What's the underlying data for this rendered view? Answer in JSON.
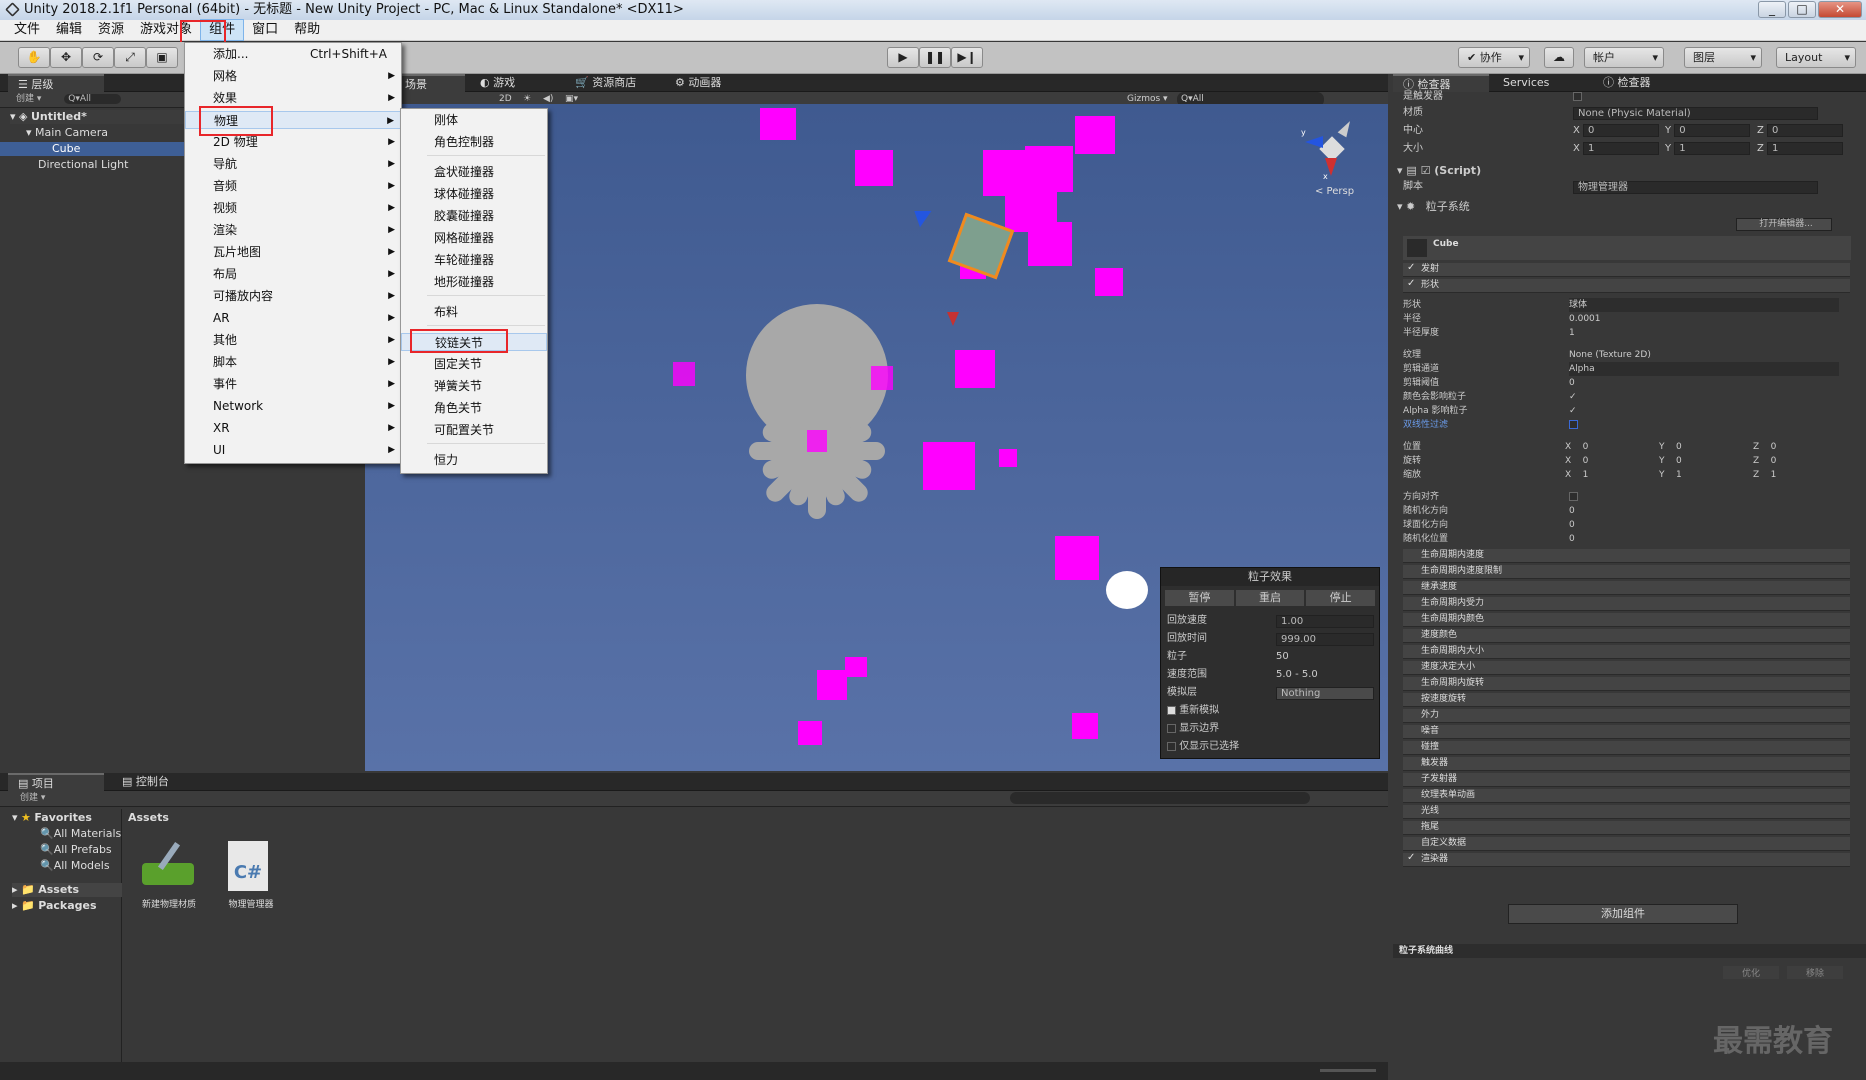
{
  "window": {
    "title": "Unity 2018.2.1f1 Personal (64bit) - 无标题 - New Unity Project - PC, Mac & Linux Standalone* <DX11>",
    "controls": [
      "_",
      "□",
      "✕"
    ]
  },
  "menubar": [
    "文件",
    "编辑",
    "资源",
    "游戏对象",
    "组件",
    "窗口",
    "帮助"
  ],
  "toolbar": {
    "collab": "✔ 协作",
    "cloud": "☁",
    "account": "帐户",
    "layers": "图层",
    "layout": "Layout"
  },
  "component_menu": {
    "items": [
      {
        "label": "添加...",
        "shortcut": "Ctrl+Shift+A"
      },
      {
        "label": "网格"
      },
      {
        "label": "效果"
      },
      {
        "label": "物理"
      },
      {
        "label": "2D 物理"
      },
      {
        "label": "导航"
      },
      {
        "label": "音频"
      },
      {
        "label": "视频"
      },
      {
        "label": "渲染"
      },
      {
        "label": "瓦片地图"
      },
      {
        "label": "布局"
      },
      {
        "label": "可播放内容"
      },
      {
        "label": "AR"
      },
      {
        "label": "其他"
      },
      {
        "label": "脚本"
      },
      {
        "label": "事件"
      },
      {
        "label": "Network"
      },
      {
        "label": "XR"
      },
      {
        "label": "UI"
      }
    ]
  },
  "physics_menu": {
    "items": [
      "刚体",
      "角色控制器",
      "盒状碰撞器",
      "球体碰撞器",
      "胶囊碰撞器",
      "网格碰撞器",
      "车轮碰撞器",
      "地形碰撞器",
      "布料",
      "铰链关节",
      "固定关节",
      "弹簧关节",
      "角色关节",
      "可配置关节",
      "恒力"
    ]
  },
  "hierarchy": {
    "tab": "层级",
    "create": "创建 ▾",
    "search": "Q▾All",
    "scene": "Untitled*",
    "items": [
      "Main Camera",
      "Cube",
      "Directional Light"
    ]
  },
  "scene_tabs": [
    "场景",
    "游戏",
    "资源商店",
    "动画器"
  ],
  "scene_bar": {
    "mode": "2D",
    "gizmos": "Gizmos ▾",
    "search": "Q▾All",
    "persp": "< Persp",
    "labels": [
      "y",
      "x"
    ]
  },
  "particle_effect": {
    "title": "粒子效果",
    "buttons": [
      "暂停",
      "重启",
      "停止"
    ],
    "rows": [
      {
        "label": "回放速度",
        "value": "1.00"
      },
      {
        "label": "回放时间",
        "value": "999.00"
      },
      {
        "label": "粒子",
        "value": "50"
      },
      {
        "label": "速度范围",
        "value": "5.0 - 5.0"
      },
      {
        "label": "模拟层",
        "value": "Nothing"
      }
    ],
    "checks": [
      {
        "label": "重新模拟",
        "checked": true
      },
      {
        "label": "显示边界",
        "checked": false
      },
      {
        "label": "仅显示已选择",
        "checked": false
      }
    ]
  },
  "project": {
    "tabs": [
      "项目",
      "控制台"
    ],
    "create": "创建 ▾",
    "favorites": "Favorites",
    "fav_items": [
      "All Materials",
      "All Prefabs",
      "All Models"
    ],
    "roots": [
      "Assets",
      "Packages"
    ],
    "assets_header": "Assets",
    "assets": [
      {
        "name": "新建物理材质"
      },
      {
        "name": "物理管理器",
        "icon": "C#"
      }
    ]
  },
  "inspector": {
    "tabs": [
      "检查器",
      "Services",
      "检查器"
    ],
    "collider": [
      {
        "label": "是触发器"
      },
      {
        "label": "材质",
        "value": "None (Physic Material)"
      },
      {
        "label": "中心",
        "x": "0",
        "y": "0",
        "z": "0"
      },
      {
        "label": "大小",
        "x": "1",
        "y": "1",
        "z": "1"
      }
    ],
    "script": {
      "header": "(Script)",
      "label": "脚本",
      "value": "物理管理器"
    },
    "ps": {
      "header": "粒子系统",
      "open_editor": "打开编辑器...",
      "name": "Cube",
      "top_modules": [
        {
          "label": "发射",
          "checked": true
        },
        {
          "label": "形状",
          "checked": true
        }
      ],
      "shape": [
        {
          "label": "形状",
          "value": "球体"
        },
        {
          "label": "半径",
          "value": "0.0001"
        },
        {
          "label": "半径厚度",
          "value": "1"
        }
      ],
      "texture": [
        {
          "label": "纹理",
          "value": "None (Texture 2D)"
        },
        {
          "label": "剪辑通道",
          "value": "Alpha"
        },
        {
          "label": "剪辑阈值",
          "value": "0"
        },
        {
          "label": "颜色会影响粒子",
          "value": "✓"
        },
        {
          "label": "Alpha 影响粒子",
          "value": "✓"
        },
        {
          "label": "双线性过滤",
          "value": ""
        }
      ],
      "transform": [
        {
          "label": "位置",
          "x": "0",
          "y": "0",
          "z": "0"
        },
        {
          "label": "旋转",
          "x": "0",
          "y": "0",
          "z": "0"
        },
        {
          "label": "缩放",
          "x": "1",
          "y": "1",
          "z": "1"
        }
      ],
      "dir": [
        {
          "label": "方向对齐",
          "value": ""
        },
        {
          "label": "随机化方向",
          "value": "0"
        },
        {
          "label": "球面化方向",
          "value": "0"
        },
        {
          "label": "随机化位置",
          "value": "0"
        }
      ],
      "modules": [
        "生命周期内速度",
        "生命周期内速度限制",
        "继承速度",
        "生命周期内受力",
        "生命周期内颜色",
        "速度颜色",
        "生命周期内大小",
        "速度决定大小",
        "生命周期内旋转",
        "按速度旋转",
        "外力",
        "噪音",
        "碰撞",
        "触发器",
        "子发射器",
        "纹理表单动画",
        "光线",
        "拖尾",
        "自定义数据",
        "渲染器"
      ]
    },
    "add_component": "添加组件",
    "curves": "粒子系统曲线",
    "curve_buttons": [
      "优化",
      "移除"
    ]
  },
  "watermark": "最需教育"
}
